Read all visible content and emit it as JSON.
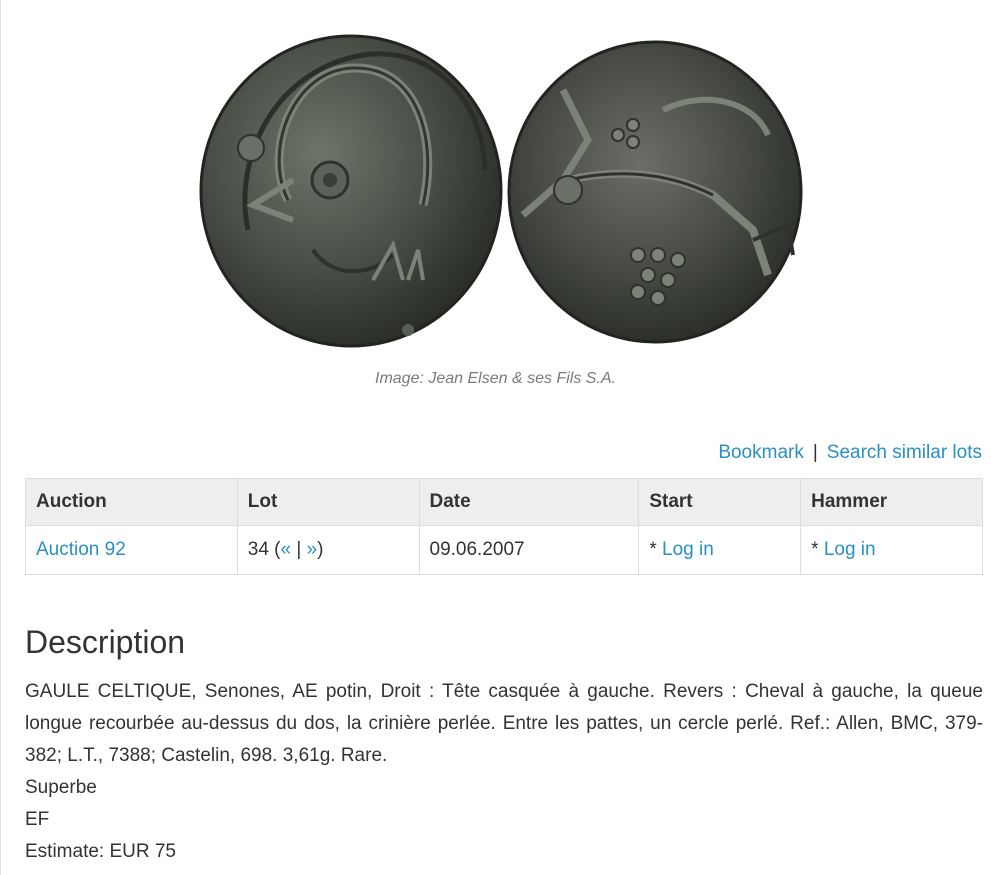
{
  "image": {
    "caption": "Image: Jean Elsen & ses Fils S.A."
  },
  "actions": {
    "bookmark": "Bookmark",
    "separator": "|",
    "search_similar": "Search similar lots"
  },
  "table": {
    "headers": [
      "Auction",
      "Lot",
      "Date",
      "Start",
      "Hammer"
    ],
    "row": {
      "auction": "Auction 92",
      "lot_number": "34 (",
      "prev": "«",
      "lot_sep": " | ",
      "next": "»",
      "lot_close": ")",
      "date": "09.06.2007",
      "start_prefix": "* ",
      "start_link": "Log in",
      "hammer_prefix": "* ",
      "hammer_link": "Log in"
    }
  },
  "description": {
    "title": "Description",
    "text": "GAULE CELTIQUE, Senones, AE potin, Droit : Tête casquée à gauche. Revers : Cheval à gauche, la queue longue recourbée au-dessus du dos, la crinière perlée. Entre les pattes, un cercle perlé. Ref.: Allen, BMC, 379-382; L.T., 7388; Castelin, 698. 3,61g. Rare.",
    "grade_fr": "Superbe",
    "grade_en": "EF",
    "estimate": "Estimate: EUR 75"
  }
}
